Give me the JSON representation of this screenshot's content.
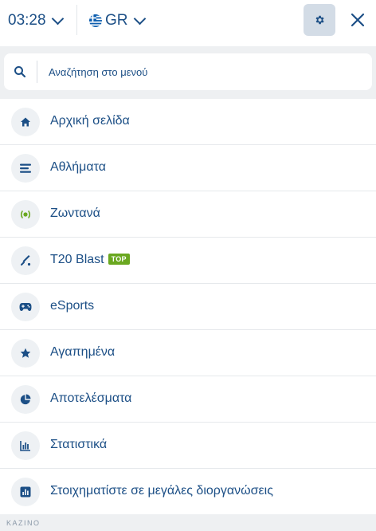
{
  "topbar": {
    "time": "03:28",
    "language_code": "GR",
    "settings_icon": "gear-icon",
    "close_icon": "close-icon"
  },
  "search": {
    "placeholder": "Αναζήτηση στο μενού",
    "value": ""
  },
  "menu": {
    "items": [
      {
        "label": "Αρχική σελίδα",
        "icon": "home-icon"
      },
      {
        "label": "Αθλήματα",
        "icon": "list-icon"
      },
      {
        "label": "Ζωντανά",
        "icon": "live-icon"
      },
      {
        "label": "T20 Blast",
        "icon": "cricket-bat-icon",
        "badge": "TOP"
      },
      {
        "label": "eSports",
        "icon": "gamepad-icon"
      },
      {
        "label": "Αγαπημένα",
        "icon": "star-icon"
      },
      {
        "label": "Αποτελέσματα",
        "icon": "pie-chart-icon"
      },
      {
        "label": "Στατιστικά",
        "icon": "bar-chart-icon"
      },
      {
        "label": "Στοιχηματίστε σε μεγάλες διοργανώσεις",
        "icon": "tournament-chart-icon"
      }
    ]
  },
  "footer": {
    "section_label": "KAZINO"
  },
  "colors": {
    "text": "#1c4f86",
    "background": "#eef0f2",
    "settings_bg": "#d3dce6",
    "badge_bg": "#6aa820",
    "icon_bg": "#eef1f4"
  }
}
